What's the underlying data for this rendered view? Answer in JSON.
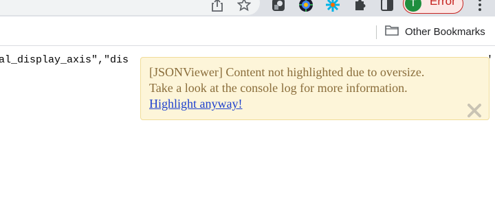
{
  "toolbar": {
    "icons": [
      "share-icon",
      "star-icon",
      "extension-icon-1",
      "extension-icon-2",
      "extension-icon-3",
      "puzzle-icon",
      "side-panel-icon",
      "menu-icon"
    ],
    "profile": {
      "initial": "T",
      "label": "Error"
    }
  },
  "bookmarks": {
    "other_label": "Other Bookmarks"
  },
  "content": {
    "json_text": "al_display_axis\",\"dis",
    "json_tail": "'"
  },
  "banner": {
    "line1": "[JSONViewer] Content not highlighted due to oversize.",
    "line2": "Take a look at the console log for more information.",
    "link": "Highlight anyway!"
  },
  "colors": {
    "banner_bg": "#fdf5d9",
    "banner_text": "#8a6d3b",
    "error": "#c5221f"
  }
}
